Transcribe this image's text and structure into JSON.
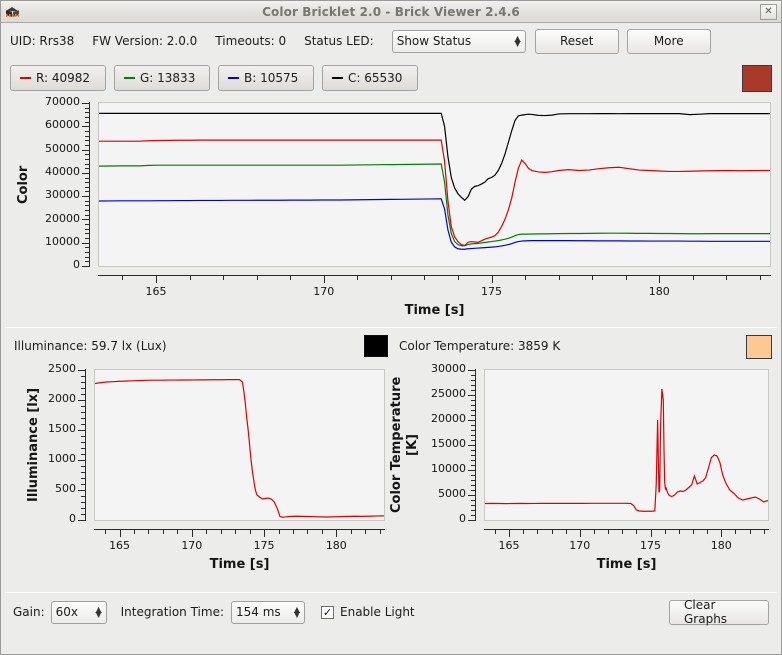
{
  "window": {
    "title": "Color Bricklet 2.0 - Brick Viewer 2.4.6",
    "icon": "brick-cube-icon",
    "close_label": "✕"
  },
  "toolbar": {
    "uid_label": "UID: Rrs38",
    "fw_label": "FW Version: 2.0.0",
    "timeouts_label": "Timeouts: 0",
    "status_led_label": "Status LED:",
    "status_led_value": "Show Status",
    "reset_label": "Reset",
    "more_label": "More"
  },
  "legend": {
    "items": [
      {
        "name": "r",
        "label": "R: 40982",
        "color": "#e00000"
      },
      {
        "name": "g",
        "label": "G: 13833",
        "color": "#008000"
      },
      {
        "name": "b",
        "label": "B: 10575",
        "color": "#0000e0"
      },
      {
        "name": "c",
        "label": "C: 65530",
        "color": "#000000"
      }
    ],
    "color_swatch": "#a93a2a"
  },
  "info": {
    "illuminance_label": "Illuminance: 59.7 lx (Lux)",
    "color_temperature_label": "Color Temperature: 3859 K",
    "illuminance_swatch": "#000000",
    "color_temperature_swatch": "#fcc894"
  },
  "bottombar": {
    "gain_label": "Gain:",
    "gain_value": "60x",
    "integration_label": "Integration Time:",
    "integration_value": "154 ms",
    "enable_light_label": "Enable Light",
    "enable_light_checked": true,
    "check_glyph": "✓",
    "clear_graphs_label": "Clear Graphs"
  },
  "chart_data": [
    {
      "id": "color",
      "type": "line",
      "title": "",
      "xlabel": "Time [s]",
      "ylabel": "Color",
      "xlim": [
        163.3,
        183.3
      ],
      "ylim": [
        0,
        70000
      ],
      "xticks": [
        165,
        170,
        175,
        180
      ],
      "yticks": [
        0,
        10000,
        20000,
        30000,
        40000,
        50000,
        60000,
        70000
      ],
      "grid": false,
      "legend": "top",
      "x": [
        163.3,
        163.6,
        163.9,
        164.2,
        164.5,
        164.8,
        165.1,
        165.4,
        165.7,
        166.0,
        166.3,
        166.6,
        166.9,
        167.2,
        167.5,
        167.8,
        168.1,
        168.4,
        168.7,
        169.0,
        169.3,
        169.6,
        169.9,
        170.2,
        170.5,
        170.8,
        171.1,
        171.4,
        171.7,
        172.0,
        172.3,
        172.6,
        172.9,
        173.2,
        173.5,
        173.6,
        173.7,
        173.8,
        173.9,
        174.0,
        174.1,
        174.2,
        174.3,
        174.4,
        174.5,
        174.6,
        174.7,
        174.8,
        174.9,
        175.0,
        175.1,
        175.2,
        175.3,
        175.4,
        175.5,
        175.6,
        175.7,
        175.8,
        175.9,
        176.0,
        176.1,
        176.2,
        176.4,
        176.6,
        176.8,
        177.0,
        177.3,
        177.6,
        177.9,
        178.2,
        178.5,
        178.8,
        179.1,
        179.4,
        179.7,
        180.0,
        180.3,
        180.6,
        180.9,
        181.2,
        181.5,
        181.8,
        182.1,
        182.4,
        182.7,
        183.0,
        183.3
      ],
      "series": [
        {
          "name": "C",
          "color": "#000000",
          "values": [
            65530,
            65530,
            65530,
            65530,
            65530,
            65530,
            65530,
            65530,
            65530,
            65530,
            65530,
            65530,
            65530,
            65530,
            65530,
            65530,
            65530,
            65530,
            65530,
            65530,
            65530,
            65530,
            65530,
            65530,
            65530,
            65530,
            65530,
            65530,
            65530,
            65530,
            65530,
            65530,
            65530,
            65530,
            65530,
            60000,
            47000,
            38000,
            33500,
            31000,
            29500,
            28200,
            29800,
            33000,
            34200,
            34500,
            35200,
            36000,
            37500,
            38000,
            39000,
            41000,
            44000,
            48000,
            53000,
            58000,
            62500,
            64500,
            64800,
            65000,
            65200,
            65100,
            64700,
            64600,
            64800,
            65300,
            65400,
            65400,
            65400,
            65450,
            65450,
            65400,
            65450,
            65450,
            65430,
            65430,
            65440,
            65440,
            65000,
            65200,
            65450,
            65450,
            65450,
            65450,
            65450,
            65450,
            65450
          ]
        },
        {
          "name": "R",
          "color": "#e00000",
          "values": [
            53600,
            53600,
            53600,
            53600,
            53600,
            53800,
            53900,
            53950,
            54000,
            54000,
            54050,
            54050,
            54050,
            54050,
            54050,
            54050,
            54050,
            54050,
            54050,
            54050,
            54050,
            54050,
            54050,
            54050,
            54050,
            54050,
            54050,
            54050,
            54050,
            54050,
            54050,
            54050,
            54050,
            54050,
            54050,
            45000,
            28000,
            17000,
            12500,
            10500,
            9200,
            8800,
            10200,
            10500,
            10300,
            10200,
            10800,
            11500,
            12000,
            12400,
            13000,
            14500,
            17000,
            20000,
            24000,
            29000,
            36000,
            42000,
            45500,
            44000,
            42000,
            41000,
            40400,
            40200,
            40500,
            41000,
            41400,
            41000,
            41200,
            41800,
            42200,
            42400,
            41800,
            41200,
            41000,
            40800,
            40600,
            40600,
            40700,
            40800,
            40900,
            40950,
            41000,
            40900,
            40950,
            41000,
            41000
          ]
        },
        {
          "name": "G",
          "color": "#008000",
          "values": [
            42900,
            42950,
            43000,
            43000,
            43000,
            43200,
            43300,
            43300,
            43300,
            43300,
            43300,
            43300,
            43300,
            43300,
            43300,
            43300,
            43300,
            43300,
            43300,
            43300,
            43300,
            43300,
            43300,
            43300,
            43300,
            43350,
            43400,
            43450,
            43500,
            43550,
            43600,
            43650,
            43700,
            43750,
            43800,
            36000,
            22000,
            14000,
            10500,
            9200,
            8700,
            8700,
            9200,
            9500,
            9600,
            9700,
            9900,
            10100,
            10300,
            10500,
            10700,
            10900,
            11200,
            11500,
            11900,
            12400,
            13000,
            13500,
            13700,
            13700,
            13700,
            13750,
            13800,
            13800,
            13850,
            13900,
            13950,
            13950,
            14000,
            14050,
            14100,
            14100,
            14050,
            14000,
            14000,
            13950,
            13950,
            13900,
            13850,
            13850,
            13900,
            13900,
            13900,
            13900,
            13900,
            13900,
            13900
          ]
        },
        {
          "name": "B",
          "color": "#0000e0",
          "values": [
            27900,
            27950,
            28000,
            28000,
            28000,
            28000,
            28050,
            28050,
            28100,
            28100,
            28150,
            28150,
            28150,
            28200,
            28200,
            28200,
            28250,
            28250,
            28250,
            28300,
            28300,
            28300,
            28350,
            28350,
            28350,
            28400,
            28450,
            28500,
            28550,
            28600,
            28650,
            28700,
            28750,
            28800,
            28850,
            24500,
            15500,
            10200,
            8200,
            7400,
            7200,
            7200,
            7400,
            7500,
            7600,
            7700,
            7800,
            7900,
            8000,
            8100,
            8200,
            8400,
            8600,
            8900,
            9200,
            9600,
            10100,
            10500,
            10700,
            10800,
            10850,
            10900,
            10900,
            10900,
            10900,
            10900,
            10900,
            10850,
            10850,
            10800,
            10800,
            10800,
            10750,
            10750,
            10700,
            10700,
            10700,
            10700,
            10650,
            10650,
            10600,
            10600,
            10600,
            10600,
            10600,
            10600,
            10600
          ]
        }
      ]
    },
    {
      "id": "illuminance",
      "type": "line",
      "title": "",
      "xlabel": "Time [s]",
      "ylabel": "Illuminance [lx]",
      "xlim": [
        163.3,
        183.3
      ],
      "ylim": [
        0,
        2500
      ],
      "xticks": [
        165,
        170,
        175,
        180
      ],
      "yticks": [
        0,
        500,
        1000,
        1500,
        2000,
        2500
      ],
      "grid": false,
      "color": "#e00000",
      "x": [
        163.3,
        163.7,
        164.1,
        164.5,
        164.9,
        165.3,
        165.7,
        166.1,
        166.5,
        166.9,
        167.3,
        167.7,
        168.1,
        168.5,
        168.9,
        169.3,
        169.7,
        170.1,
        170.5,
        170.9,
        171.3,
        171.7,
        172.1,
        172.5,
        172.9,
        173.3,
        173.5,
        173.6,
        173.7,
        173.8,
        173.9,
        174.0,
        174.1,
        174.2,
        174.3,
        174.4,
        174.5,
        174.7,
        174.9,
        175.1,
        175.3,
        175.5,
        175.7,
        175.9,
        176.1,
        176.3,
        176.6,
        176.9,
        177.3,
        177.7,
        178.1,
        178.5,
        178.9,
        179.3,
        179.7,
        180.1,
        180.5,
        180.9,
        181.3,
        181.7,
        182.1,
        182.5,
        182.9,
        183.3
      ],
      "values": [
        2275,
        2290,
        2300,
        2305,
        2310,
        2315,
        2318,
        2322,
        2325,
        2328,
        2330,
        2330,
        2330,
        2332,
        2332,
        2333,
        2333,
        2334,
        2335,
        2336,
        2337,
        2338,
        2338,
        2339,
        2340,
        2340,
        2300,
        2150,
        1950,
        1700,
        1500,
        1250,
        1000,
        800,
        640,
        500,
        420,
        380,
        350,
        360,
        365,
        350,
        300,
        200,
        60,
        45,
        55,
        60,
        62,
        60,
        58,
        55,
        52,
        50,
        52,
        55,
        58,
        60,
        62,
        60,
        62,
        65,
        68,
        70
      ]
    },
    {
      "id": "color_temperature",
      "type": "line",
      "title": "",
      "xlabel": "Time [s]",
      "ylabel": "Color Temperature [K]",
      "xlim": [
        163.3,
        183.3
      ],
      "ylim": [
        0,
        30000
      ],
      "xticks": [
        165,
        170,
        175,
        180
      ],
      "yticks": [
        0,
        5000,
        10000,
        15000,
        20000,
        25000,
        30000
      ],
      "grid": false,
      "color": "#e00000",
      "x": [
        163.3,
        163.8,
        164.3,
        164.8,
        165.3,
        165.8,
        166.3,
        166.8,
        167.3,
        167.8,
        168.3,
        168.8,
        169.3,
        169.8,
        170.3,
        170.8,
        171.3,
        171.8,
        172.3,
        172.8,
        173.3,
        173.6,
        173.8,
        174.0,
        174.2,
        174.5,
        174.8,
        175.1,
        175.3,
        175.4,
        175.5,
        175.55,
        175.6,
        175.65,
        175.7,
        175.8,
        175.9,
        175.95,
        176.0,
        176.05,
        176.1,
        176.2,
        176.3,
        176.4,
        176.5,
        176.7,
        176.9,
        177.1,
        177.3,
        177.5,
        177.7,
        177.9,
        178.1,
        178.3,
        178.5,
        178.7,
        178.9,
        179.1,
        179.3,
        179.5,
        179.7,
        179.9,
        180.1,
        180.3,
        180.6,
        180.9,
        181.2,
        181.5,
        181.8,
        182.1,
        182.4,
        182.7,
        183.0,
        183.3
      ],
      "values": [
        3300,
        3320,
        3300,
        3280,
        3300,
        3320,
        3300,
        3310,
        3330,
        3330,
        3330,
        3330,
        3330,
        3330,
        3330,
        3340,
        3340,
        3340,
        3340,
        3340,
        3340,
        3300,
        2900,
        2000,
        1800,
        1750,
        1750,
        1750,
        1800,
        7000,
        20000,
        12000,
        5500,
        6000,
        18000,
        26200,
        24000,
        14000,
        7500,
        6200,
        6400,
        5500,
        5000,
        4800,
        4700,
        5000,
        5600,
        5800,
        5700,
        6000,
        6500,
        7000,
        8800,
        7200,
        7500,
        7800,
        8500,
        10500,
        12500,
        13000,
        12800,
        11500,
        9000,
        7500,
        6000,
        5300,
        4400,
        4000,
        4200,
        4400,
        4600,
        4200,
        3600,
        3900
      ]
    }
  ]
}
